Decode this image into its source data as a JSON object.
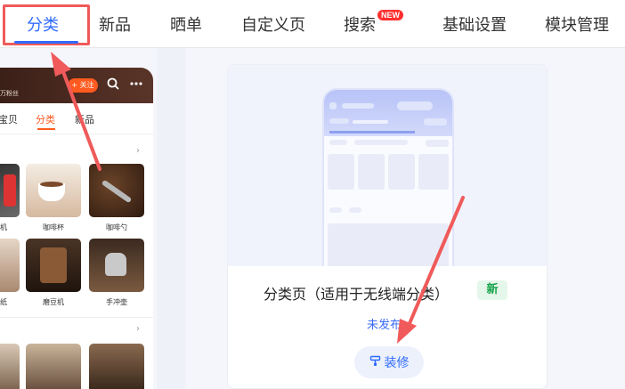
{
  "tabs": [
    {
      "label": "分类",
      "active": true
    },
    {
      "label": "新品",
      "active": false
    },
    {
      "label": "晒单",
      "active": false
    },
    {
      "label": "自定义页",
      "active": false
    },
    {
      "label": "搜索",
      "active": false,
      "badge": "NEW"
    },
    {
      "label": "基础设置",
      "active": false
    },
    {
      "label": "模块管理",
      "active": false
    }
  ],
  "phone": {
    "fans_text": "万粉丝",
    "follow_label": "+ 关注",
    "tabs": [
      "宝贝",
      "分类",
      "新品"
    ],
    "active_tab": "分类",
    "chevron": "›",
    "row1_labels": [
      "机",
      "咖啡杯",
      "咖啡勺"
    ],
    "row2_labels": [
      "纸",
      "磨豆机",
      "手冲壶"
    ]
  },
  "template_card": {
    "title": "分类页（适用于无线端分类）",
    "new_tag": "新",
    "status": "未发布",
    "button_label": "装修"
  },
  "colors": {
    "accent_blue": "#2f6bff",
    "annotation_red": "#f05a5a",
    "phone_orange": "#ff5a1f",
    "new_green": "#17a34a"
  },
  "icons": {
    "search": "search-icon",
    "more": "more-icon",
    "decorate": "brush-icon"
  }
}
